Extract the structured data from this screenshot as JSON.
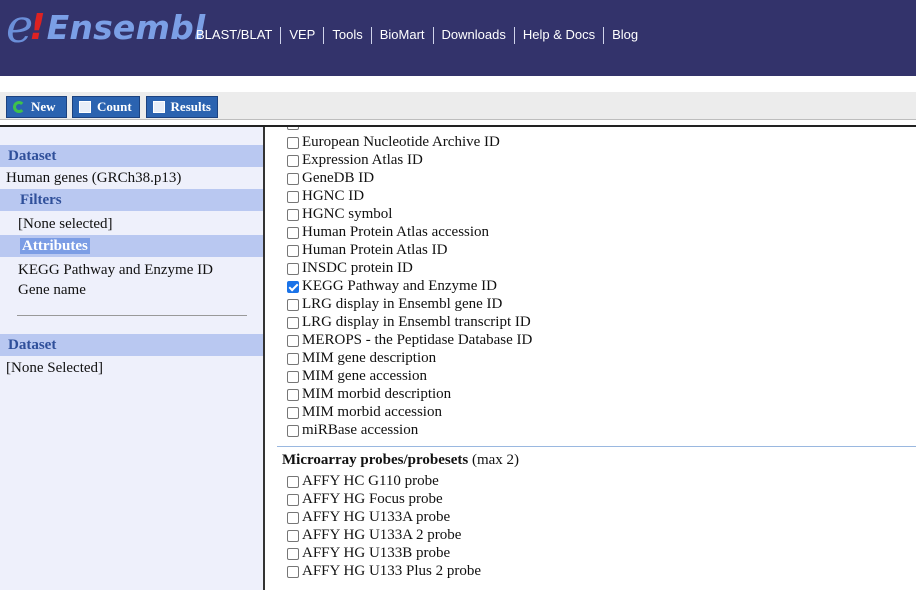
{
  "masthead": {
    "logo": {
      "e": "e",
      "bang": "!",
      "text": "Ensembl"
    },
    "nav": [
      "BLAST/BLAT",
      "VEP",
      "Tools",
      "BioMart",
      "Downloads",
      "Help & Docs",
      "Blog"
    ]
  },
  "toolbar": {
    "new_label": "New",
    "count_label": "Count",
    "results_label": "Results"
  },
  "left": {
    "dataset_heading": "Dataset",
    "dataset_value": "Human genes (GRCh38.p13)",
    "filters_heading": "Filters",
    "filters_value": "[None selected]",
    "attributes_heading": "Attributes",
    "attributes": [
      "KEGG Pathway and Enzyme ID",
      "Gene name"
    ],
    "dataset2_heading": "Dataset",
    "dataset2_value": "[None Selected]"
  },
  "right": {
    "external_ids": [
      {
        "label": "European Nucleotide Archive ID",
        "checked": false
      },
      {
        "label": "Expression Atlas ID",
        "checked": false
      },
      {
        "label": "GeneDB ID",
        "checked": false
      },
      {
        "label": "HGNC ID",
        "checked": false
      },
      {
        "label": "HGNC symbol",
        "checked": false
      },
      {
        "label": "Human Protein Atlas accession",
        "checked": false
      },
      {
        "label": "Human Protein Atlas ID",
        "checked": false
      },
      {
        "label": "INSDC protein ID",
        "checked": false
      },
      {
        "label": "KEGG Pathway and Enzyme ID",
        "checked": true
      },
      {
        "label": "LRG display in Ensembl gene ID",
        "checked": false
      },
      {
        "label": "LRG display in Ensembl transcript ID",
        "checked": false
      },
      {
        "label": "MEROPS - the Peptidase Database ID",
        "checked": false
      },
      {
        "label": "MIM gene description",
        "checked": false
      },
      {
        "label": "MIM gene accession",
        "checked": false
      },
      {
        "label": "MIM morbid description",
        "checked": false
      },
      {
        "label": "MIM morbid accession",
        "checked": false
      },
      {
        "label": "miRBase accession",
        "checked": false
      }
    ],
    "microarray_title": "Microarray probes/probesets",
    "microarray_suffix": "(max 2)",
    "microarray": [
      {
        "label": "AFFY HC G110 probe",
        "checked": false
      },
      {
        "label": "AFFY HG Focus probe",
        "checked": false
      },
      {
        "label": "AFFY HG U133A probe",
        "checked": false
      },
      {
        "label": "AFFY HG U133A 2 probe",
        "checked": false
      },
      {
        "label": "AFFY HG U133B probe",
        "checked": false
      },
      {
        "label": "AFFY HG U133 Plus 2 probe",
        "checked": false
      }
    ]
  }
}
